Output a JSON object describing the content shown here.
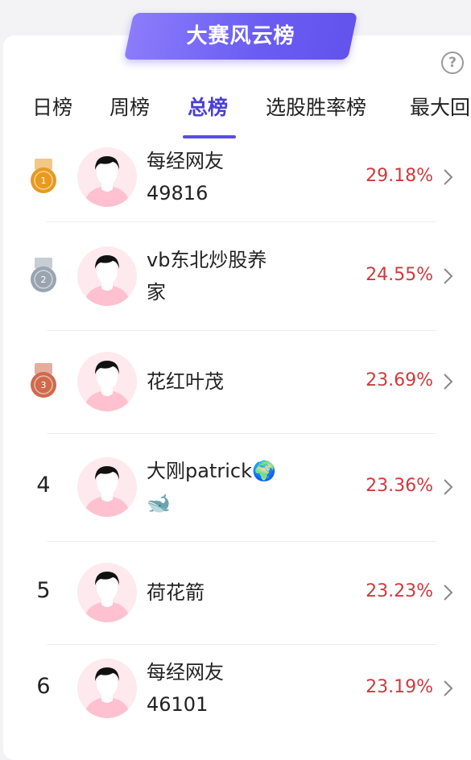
{
  "banner": {
    "title": "大赛风云榜"
  },
  "help": {
    "icon": "help-icon",
    "glyph": "?"
  },
  "tabs": [
    {
      "label": "日榜",
      "active": false
    },
    {
      "label": "周榜",
      "active": false
    },
    {
      "label": "总榜",
      "active": true
    },
    {
      "label": "选股胜率榜",
      "active": false
    },
    {
      "label": "最大回",
      "active": false
    }
  ],
  "colors": {
    "accent": "#5a4ce6",
    "percent": "#d0393d",
    "gold": "#e79a21",
    "silver": "#9aa4b1",
    "bronze": "#cf6a4d"
  },
  "leaderboard": [
    {
      "rank": "1",
      "medal": "gold",
      "name_line1": "每经网友",
      "name_line2": "49816",
      "percent": "29.18%"
    },
    {
      "rank": "2",
      "medal": "silver",
      "name_line1": "vb东北炒股养",
      "name_line2": "家",
      "percent": "24.55%"
    },
    {
      "rank": "3",
      "medal": "bronze",
      "name_line1": "花红叶茂",
      "name_line2": "",
      "percent": "23.69%"
    },
    {
      "rank": "4",
      "medal": "",
      "name_line1": "大刚patrick🌍",
      "name_line2": "🐋",
      "percent": "23.36%"
    },
    {
      "rank": "5",
      "medal": "",
      "name_line1": "荷花箭",
      "name_line2": "",
      "percent": "23.23%"
    },
    {
      "rank": "6",
      "medal": "",
      "name_line1": "每经网友",
      "name_line2": "46101",
      "percent": "23.19%"
    }
  ]
}
